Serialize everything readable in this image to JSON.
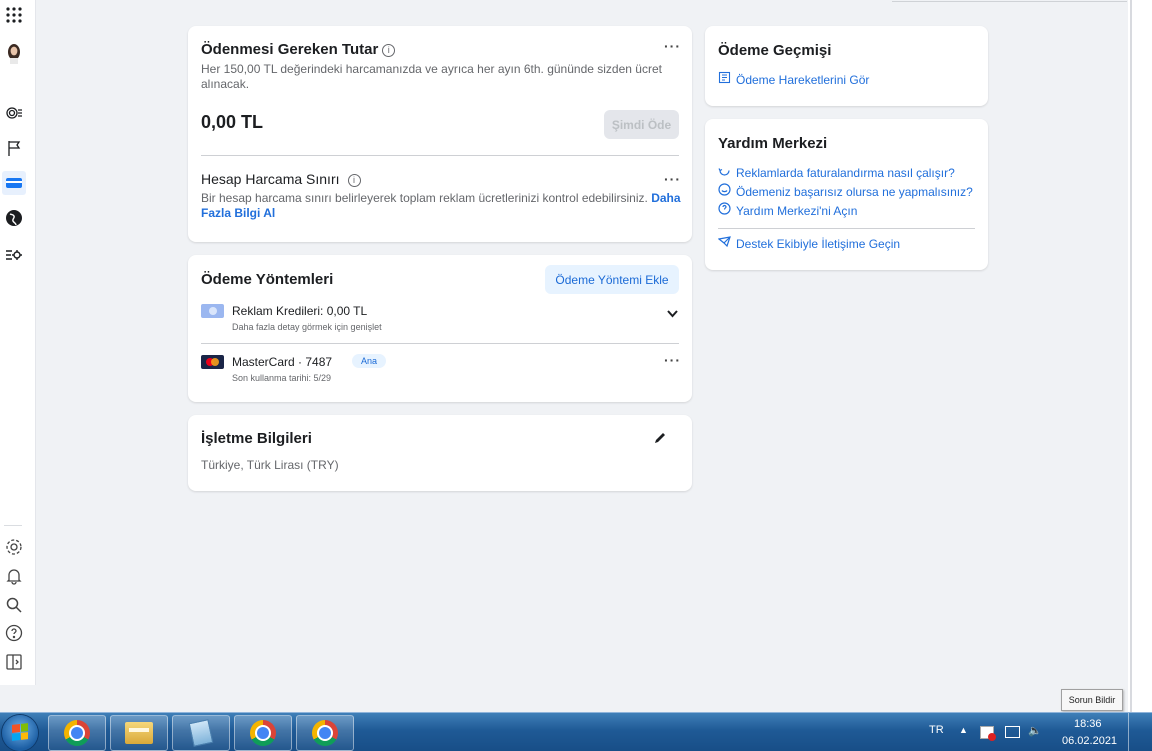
{
  "payment_due": {
    "title": "Ödenmesi Gereken Tutar",
    "description": "Her 150,00 TL değerindeki harcamanızda ve ayrıca her ayın 6th. gününde sizden ücret alınacak.",
    "amount": "0,00 TL",
    "pay_now_label": "Şimdi Öde",
    "limit_title": "Hesap Harcama Sınırı",
    "limit_description": "Bir hesap harcama sınırı belirleyerek toplam reklam ücretlerinizi kontrol edebilirsiniz.",
    "limit_link_1": "Daha",
    "limit_link_2": "Fazla Bilgi Al"
  },
  "payment_methods": {
    "title": "Ödeme Yöntemleri",
    "add_label": "Ödeme Yöntemi Ekle",
    "credit_title": "Reklam Kredileri: 0,00 TL",
    "credit_sub": "Daha fazla detay görmek için genişlet",
    "card_title": "MasterCard · 7487",
    "card_badge": "Ana",
    "card_sub": "Son kullanma tarihi: 5/29"
  },
  "business_info": {
    "title": "İşletme Bilgileri",
    "value": "Türkiye, Türk Lirası (TRY)"
  },
  "history": {
    "title": "Ödeme Geçmişi",
    "link": "Ödeme Hareketlerini Gör"
  },
  "help_center": {
    "title": "Yardım Merkezi",
    "links": [
      "Reklamlarda faturalandırma nasıl çalışır?",
      "Ödemeniz başarısız olursa ne yapmalısınız?",
      "Yardım Merkezi'ni Açın"
    ],
    "contact": "Destek Ekibiyle İletişime Geçin"
  },
  "tooltip": "Sorun Bildir",
  "taskbar": {
    "lang": "TR",
    "time": "18:36",
    "date": "06.02.2021"
  }
}
